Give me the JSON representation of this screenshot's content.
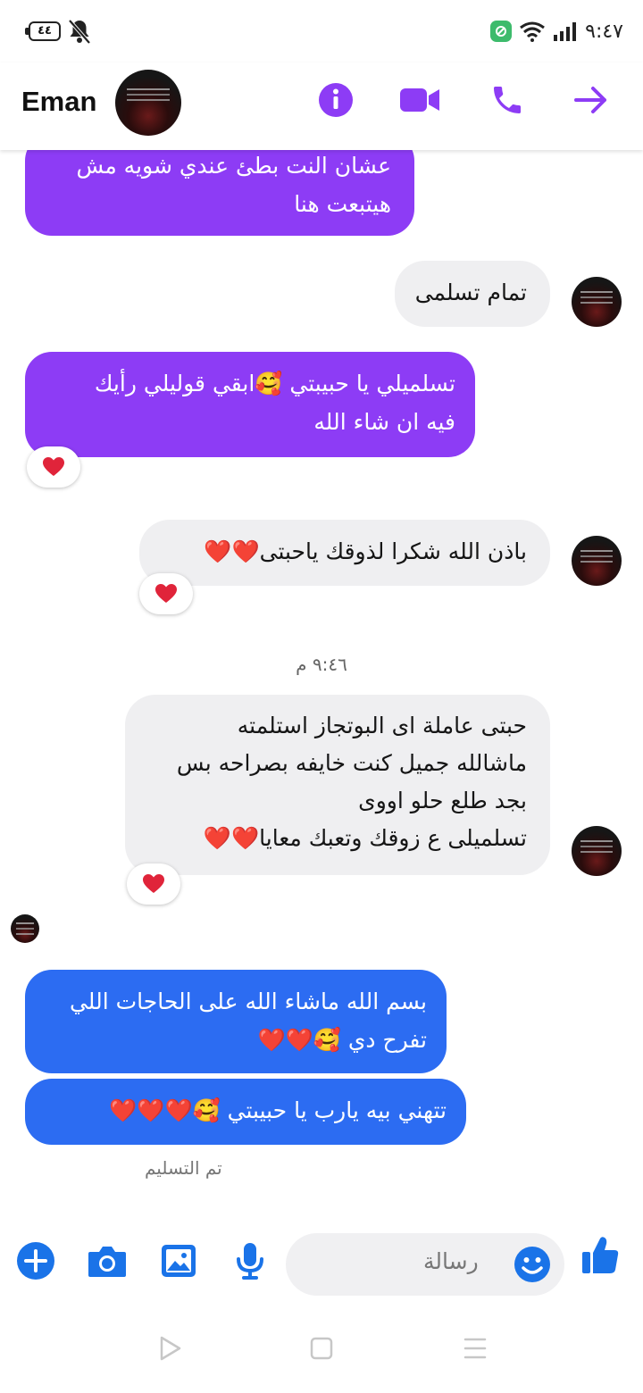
{
  "status_bar": {
    "battery": "٤٤",
    "time": "٩:٤٧",
    "icons": [
      "battery-icon",
      "bell-muted-icon",
      "app-badge-icon",
      "wifi-icon",
      "signal-icon"
    ]
  },
  "header": {
    "contact_name": "Eman",
    "icons": [
      "info-icon",
      "video-call-icon",
      "phone-icon",
      "forward-arrow-icon"
    ],
    "accent_color": "#8d3cf5"
  },
  "messages": [
    {
      "id": 1,
      "direction": "sent",
      "style": "purple",
      "lines": [
        "عشان النت بطئ عندي شويه مش",
        "هيتبعت هنا"
      ]
    },
    {
      "id": 2,
      "direction": "received",
      "lines": [
        "تمام تسلمى"
      ]
    },
    {
      "id": 3,
      "direction": "sent",
      "style": "purple",
      "lines": [
        "تسلميلي يا حبيبتي 🥰ابقي قوليلي رأيك",
        "فيه ان شاء الله"
      ],
      "reaction": "❤️"
    },
    {
      "id": 4,
      "direction": "received",
      "lines": [
        "باذن الله شكرا لذوقك ياحبتى❤️❤️"
      ],
      "reaction": "❤️"
    },
    {
      "id": 5,
      "direction": "received",
      "lines": [
        "حبتى عاملة اى البوتجاز استلمته",
        "ماشالله جميل كنت خايفه بصراحه بس",
        "بجد طلع حلو اووى",
        "تسلميلى ع زوقك وتعبك معايا❤️❤️"
      ],
      "reaction": "❤️"
    },
    {
      "id": 6,
      "direction": "sent",
      "style": "blue",
      "lines": [
        "بسم الله ماشاء الله على الحاجات اللي",
        "تفرح دي 🥰❤️❤️"
      ]
    },
    {
      "id": 7,
      "direction": "sent",
      "style": "blue",
      "lines": [
        "تتهني بيه يارب يا حبيبتي 🥰❤️❤️❤️"
      ]
    }
  ],
  "timestamp": "٩:٤٦ م",
  "delivered_label": "تم التسليم",
  "composer": {
    "placeholder": "رسالة",
    "icons": [
      "plus-icon",
      "camera-icon",
      "gallery-icon",
      "mic-icon",
      "emoji-icon",
      "thumbs-up-icon"
    ],
    "color": "#1a73e8"
  },
  "nav_bar": [
    "back-icon",
    "home-icon",
    "recents-icon"
  ],
  "colors": {
    "purple_bubble": "#8d3cf5",
    "blue_bubble": "#2c6cf2",
    "grey_bubble": "#efeff1",
    "reaction_heart": "#e0243a"
  }
}
